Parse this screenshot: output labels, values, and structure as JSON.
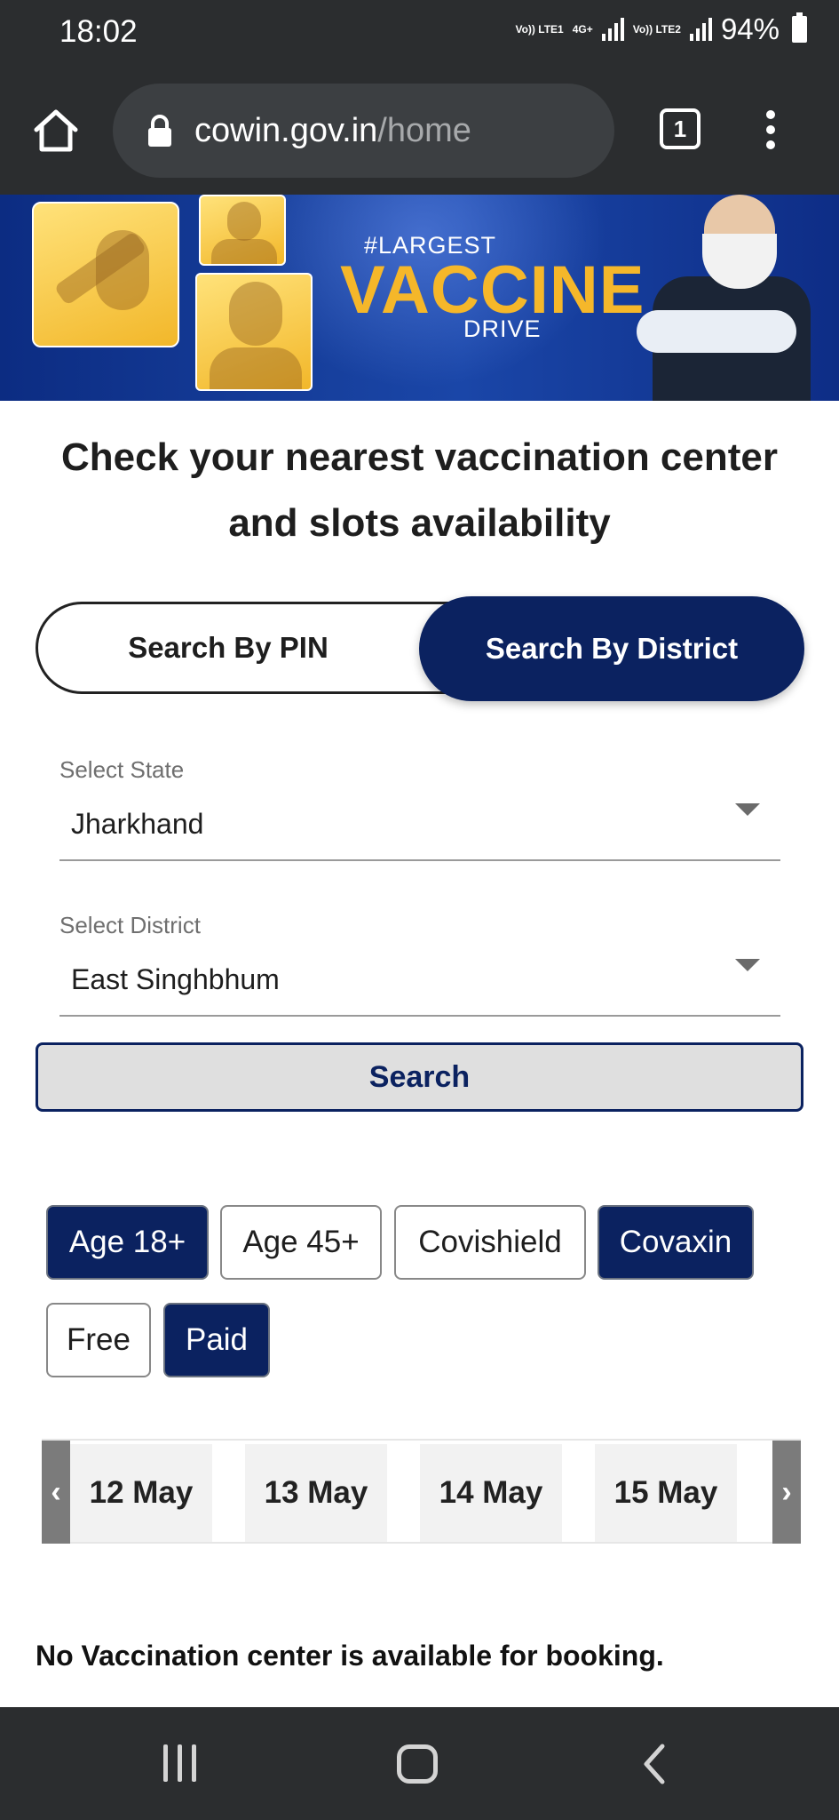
{
  "status_bar": {
    "time": "18:02",
    "sim1_tag": "Vo)) LTE1",
    "net_tag": "4G+",
    "sim2_tag": "Vo)) LTE2",
    "battery": "94%"
  },
  "browser": {
    "url_domain": "cowin.gov.in",
    "url_path": "/home",
    "tab_count": "1"
  },
  "banner": {
    "hashtag": "#LARGEST",
    "title": "VACCINE",
    "subtitle": "DRIVE"
  },
  "headline": "Check your nearest vaccination center and slots availability",
  "search_toggle": {
    "pin_label": "Search By PIN",
    "district_label": "Search By District",
    "selected": "district"
  },
  "state_field": {
    "label": "Select State",
    "value": "Jharkhand"
  },
  "district_field": {
    "label": "Select District",
    "value": "East Singhbhum"
  },
  "search_button": "Search",
  "filters": [
    {
      "label": "Age 18+",
      "active": true
    },
    {
      "label": "Age 45+",
      "active": false
    },
    {
      "label": "Covishield",
      "active": false
    },
    {
      "label": "Covaxin",
      "active": true
    },
    {
      "label": "Free",
      "active": false
    },
    {
      "label": "Paid",
      "active": true
    }
  ],
  "dates": [
    "12 May",
    "13 May",
    "14 May",
    "15 May"
  ],
  "empty_message": "No Vaccination center is available for booking.",
  "colors": {
    "primary_navy": "#0b2260",
    "banner_blue": "#17409e",
    "banner_gold": "#f5b72a",
    "chrome_dark": "#2b2d2f"
  }
}
